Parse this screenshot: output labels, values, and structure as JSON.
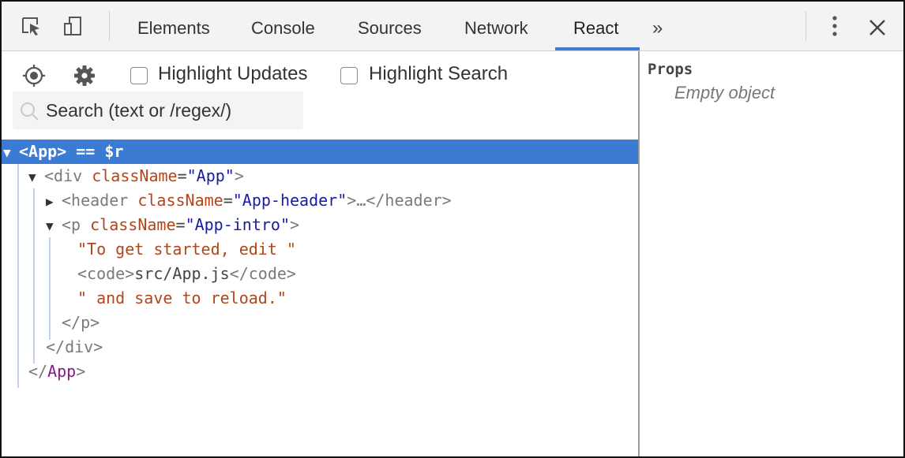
{
  "toolbar": {
    "tabs": [
      "Elements",
      "Console",
      "Sources",
      "Network",
      "React"
    ],
    "active_tab": "React",
    "more_label": "»",
    "icons": [
      "inspect-icon",
      "device-toolbar-icon",
      "more-vert-icon",
      "close-icon"
    ]
  },
  "controls": {
    "highlight_updates_label": "Highlight Updates",
    "highlight_search_label": "Highlight Search",
    "highlight_updates_checked": false,
    "highlight_search_checked": false,
    "search_placeholder": "Search (text or /regex/)"
  },
  "tree": {
    "selected_node": "<App>",
    "selected_suffix": " == $r",
    "div_tag": "div",
    "div_attr": "className",
    "div_value": "\"App\"",
    "header_tag": "header",
    "header_attr": "className",
    "header_value": "\"App-header\"",
    "header_collapsed": "…</header>",
    "p_tag": "p",
    "p_attr": "className",
    "p_value": "\"App-intro\"",
    "text1": "\"To get started, edit \"",
    "code_open": "<code>",
    "code_text": "src/App.js",
    "code_close": "</code>",
    "text2": "\" and save to reload.\"",
    "p_close": "</p>",
    "div_close": "</div>",
    "app_close_name": "App"
  },
  "sidebar": {
    "title": "Props",
    "empty_text": "Empty object"
  },
  "colors": {
    "selection": "#3b7bd4",
    "tab_underline": "#3d7dd6",
    "attr_name": "#b1461b",
    "attr_value": "#1a1aa6",
    "component_name": "#8a1a8a"
  }
}
